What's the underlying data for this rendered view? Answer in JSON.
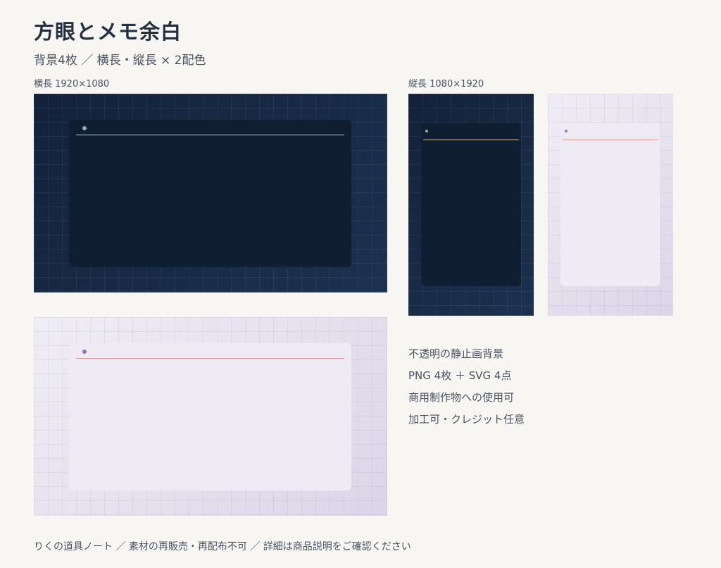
{
  "header": {
    "title": "方眼とメモ余白",
    "subtitle": "背景4枚 ／ 横長・縦長 × 2配色"
  },
  "sections": {
    "landscape_label": "横長 1920×1080",
    "portrait_label": "縦長 1080×1920"
  },
  "colors": {
    "page_bg": "#f7f6f2",
    "navy": "#172a44",
    "navy_card": "#0f1e31",
    "lavender": "#e6e2ee",
    "lavender_card": "#eeebf4",
    "gold_rule": "#d8c6a2",
    "rose_rule": "#d79a98"
  },
  "features": [
    "不透明の静止画背景",
    "PNG 4枚 ＋ SVG 4点",
    "商用制作物への使用可",
    "加工可・クレジット任意"
  ],
  "footer": {
    "text": "りくの道具ノート ／ 素材の再販売・再配布不可 ／ 詳細は商品説明をご確認ください"
  }
}
